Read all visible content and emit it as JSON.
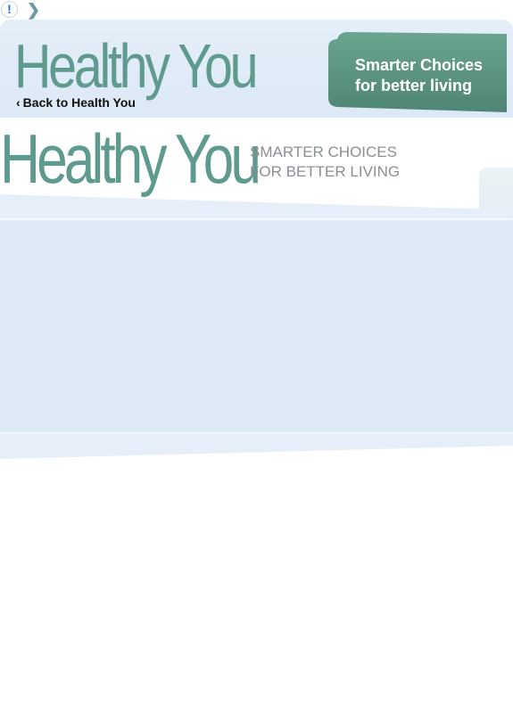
{
  "topbar": {
    "alert_glyph": "!",
    "chevron_glyph": "❯"
  },
  "header": {
    "logo_text": "Healthy You",
    "back_link": "Back to Health You",
    "badge": {
      "line1": "Smarter Choices",
      "line2": "for better living",
      "color": "#5e9683"
    }
  },
  "hero": {
    "logo_text": "Healthy You",
    "tagline_line1": "SMARTER CHOICES",
    "tagline_line2": "FOR BETTER LIVING"
  },
  "colors": {
    "brand_teal": "#5f9a8e",
    "panel_blue": "#e0ecf8"
  }
}
